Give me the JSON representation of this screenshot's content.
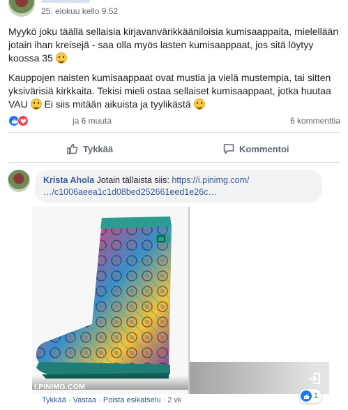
{
  "post": {
    "timestamp": "25. elokuu kello 9.52",
    "paragraph1": "Myykö joku täällä sellaisia kirjavanvärikkääniloisia kumisaappaita, mielellään jotain ihan kreisejä - saa olla myös lasten kumisaappaat, jos sitä löytyy koossa 35",
    "paragraph2": "Kauppojen naisten kumisaappaat ovat mustia ja vielä mustempia, tai sitten yksivärisiä kirkkaita. Tekisi mieli ostaa sellaiset kumisaappaat, jotka huutaa VAU",
    "paragraph2b": "Ei siis mitään aikuista ja tyylikästä",
    "emoji": "smiley-icon"
  },
  "reactions": {
    "names": "ja 6 muuta",
    "comments": "6 kommenttia",
    "icons": [
      "like-icon",
      "love-icon"
    ]
  },
  "actions": {
    "like_label": "Tykkää",
    "comment_label": "Kommentoi"
  },
  "comment": {
    "author": "Krista Ahola",
    "text": "Jotain tällaista siis: ",
    "link_line1": "https://i.pinimg.com/",
    "link_line2": "…/c1006aeea1c1d08bed252661eed1e26c…",
    "preview_domain": "I.PINIMG.COM",
    "actions": {
      "like": "Tykkää",
      "reply": "Vastaa",
      "remove_preview": "Poista esikatselu",
      "time": "2 vk"
    },
    "like_count": "1"
  },
  "colors": {
    "accent": "#385898",
    "like_blue": "#1877f2",
    "love_red": "#f33e58",
    "muted": "#606770"
  }
}
